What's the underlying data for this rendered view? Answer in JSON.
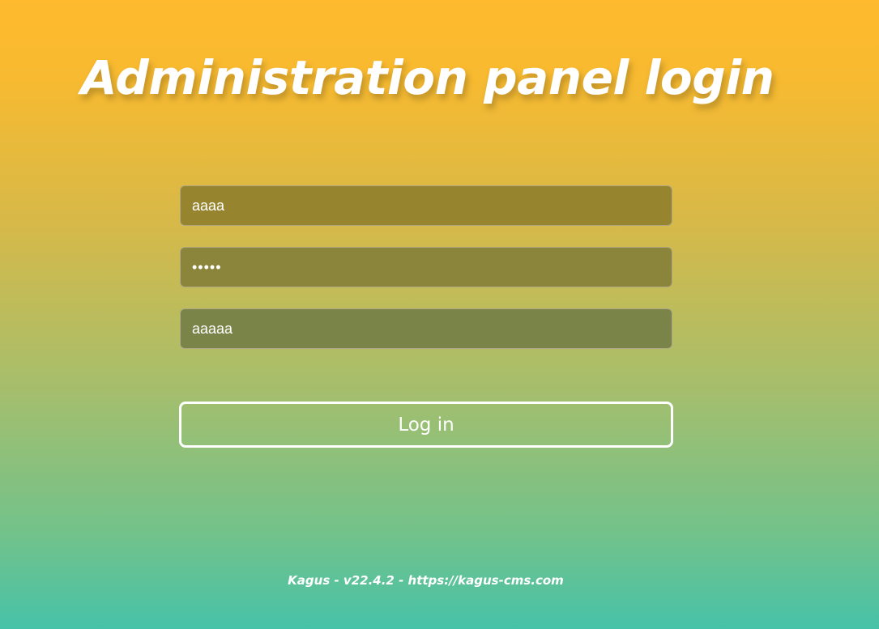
{
  "page": {
    "title": "Administration panel login"
  },
  "form": {
    "username_value": "aaaa",
    "password_value": "aaaaa",
    "code_value": "aaaaa",
    "submit_label": "Log in"
  },
  "footer": {
    "text": "Kagus - v22.4.2 - https://kagus-cms.com"
  },
  "colors": {
    "gradient_top": "#ffba2e",
    "gradient_bottom": "#47c2a8",
    "text": "#ffffff"
  }
}
